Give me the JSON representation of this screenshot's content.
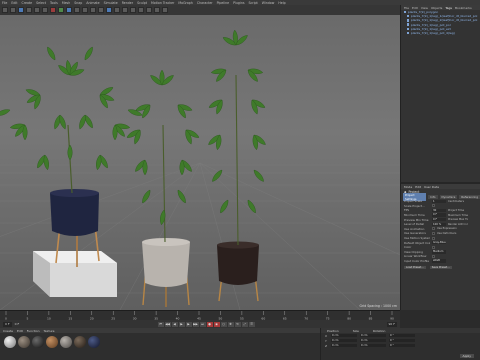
{
  "menubar": {
    "items": [
      "File",
      "Edit",
      "Create",
      "Select",
      "Tools",
      "Mesh",
      "Snap",
      "Animate",
      "Simulate",
      "Render",
      "Sculpt",
      "Motion Tracker",
      "MoGraph",
      "Character",
      "Pipeline",
      "Plugins",
      "Script",
      "Window",
      "Help"
    ]
  },
  "object_manager": {
    "tabs": [
      "File",
      "Edit",
      "View",
      "Objects",
      "Tags",
      "Bookmarks"
    ],
    "rows": [
      "plants_7(9)_polygon",
      "plants_7(9)_1(leg)_1(leaf)hor_dt_blurred_pol",
      "plants_7(9)_1(leg)_2(leaf)hor_dt_blurred_pol",
      "plants_7(9)_1(leg)_pot_pol",
      "plants_7(9)_1(leg)_pot_ext",
      "plants_7(9)_1(leg)_pot_4(leg)"
    ]
  },
  "attributes": {
    "header": [
      "Mode",
      "Edit",
      "User Data"
    ],
    "title": "Project",
    "tabs": [
      "Project Settings",
      "Info",
      "Dynamics",
      "Referencing"
    ],
    "rows": [
      {
        "label": "Project Scale",
        "value": "1",
        "extra": "Centimeters"
      },
      {
        "label": "Scale Project...",
        "value": "",
        "extra": ""
      },
      {
        "label": "FPS",
        "value": "30",
        "extra": "Project Time"
      },
      {
        "label": "Minimum Time",
        "value": "0 F",
        "extra": "Maximum Time"
      },
      {
        "label": "Preview Min Time",
        "value": "0 F",
        "extra": "Preview Max Time"
      },
      {
        "label": "Level of Detail",
        "value": "100 %",
        "extra": "Render LOD in Editor"
      },
      {
        "label": "Use Animation",
        "value": "",
        "extra": "Use Expression"
      },
      {
        "label": "Use Generators",
        "value": "",
        "extra": "Use Deformers"
      },
      {
        "label": "Use Motion System",
        "value": "",
        "extra": ""
      },
      {
        "label": "Default Object Color",
        "value": "Gray-Blue",
        "extra": ""
      },
      {
        "label": "Color",
        "value": "",
        "extra": ""
      },
      {
        "label": "View Clipping",
        "value": "Medium",
        "extra": ""
      },
      {
        "label": "Linear Workflow",
        "value": "",
        "extra": ""
      },
      {
        "label": "Input Color Profile",
        "value": "sRGB",
        "extra": ""
      }
    ],
    "buttons": [
      "Load Preset...",
      "Save Preset..."
    ]
  },
  "viewport": {
    "status": "Grid Spacing : 1000 cm"
  },
  "timeline": {
    "ticks": [
      "0",
      "5",
      "10",
      "15",
      "20",
      "25",
      "30",
      "35",
      "40",
      "45",
      "50",
      "55",
      "60",
      "65",
      "70",
      "75",
      "80",
      "85",
      "90"
    ],
    "frame_start": "0 F",
    "frame_end": "90 F",
    "current": "0 F"
  },
  "materials": {
    "menu": [
      "Create",
      "Edit",
      "Function",
      "Texture"
    ]
  },
  "coordinates": {
    "header": [
      "Position",
      "Size",
      "Rotation"
    ],
    "rows": [
      {
        "axis": "X",
        "pos": "0 cm",
        "size": "0 cm",
        "rot": "0 °"
      },
      {
        "axis": "Y",
        "pos": "0 cm",
        "size": "0 cm",
        "rot": "0 °"
      },
      {
        "axis": "Z",
        "pos": "0 cm",
        "size": "0 cm",
        "rot": "0 °"
      }
    ],
    "apply": "Apply"
  },
  "colors": {
    "accent": "#5f7fae",
    "viewport_bg": "#707070",
    "leaf": "#3f7a2a",
    "record": "#a63838"
  }
}
